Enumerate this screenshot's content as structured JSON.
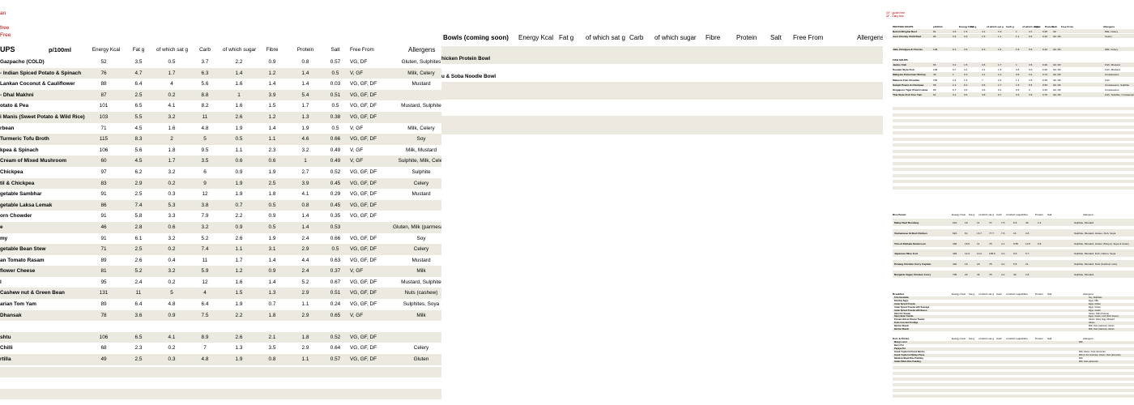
{
  "left": {
    "legend": [
      "an",
      "free",
      "Free"
    ],
    "header": {
      "section": "UPS",
      "per": "p/100ml",
      "kcal": "Energy Kcal",
      "fat": "Fat g",
      "sat": "of which sat g",
      "carb": "Carb",
      "sugar": "of which sugar",
      "fibre": "Fibre",
      "protein": "Protein",
      "salt": "Salt",
      "free": "Free From",
      "allergens": "Allergens"
    },
    "rows": [
      {
        "name": "Gazpacho (COLD)",
        "kcal": "52",
        "fat": "3.5",
        "sat": "0.5",
        "carb": "3.7",
        "sugar": "2.2",
        "fibre": "0.9",
        "protein": "0.8",
        "salt": "0.57",
        "free": "VG, DF",
        "allergens": "Gluten, Sulphites"
      },
      {
        "name": "- Indian Spiced Potato & Spinach",
        "kcal": "76",
        "fat": "4.7",
        "sat": "1.7",
        "carb": "6.3",
        "sugar": "1.4",
        "fibre": "1.2",
        "protein": "1.4",
        "salt": "0.5",
        "free": "V, GF",
        "allergens": "Milk, Celery"
      },
      {
        "name": "Lankan Coconut & Cauliflower",
        "kcal": "88",
        "fat": "6.4",
        "sat": "4",
        "carb": "5.6",
        "sugar": "1.6",
        "fibre": "1.4",
        "protein": "1.4",
        "salt": "0.03",
        "free": "VG, GF, DF",
        "allergens": "Mustard"
      },
      {
        "name": "- Dhal Makhni",
        "kcal": "87",
        "fat": "2.5",
        "sat": "0.2",
        "carb": "8.8",
        "sugar": "1",
        "fibre": "3.9",
        "protein": "5.4",
        "salt": "0.51",
        "free": "VG, GF, DF",
        "allergens": ""
      },
      {
        "name": "otato & Pea",
        "kcal": "101",
        "fat": "6.5",
        "sat": "4.1",
        "carb": "8.2",
        "sugar": "1.6",
        "fibre": "1.5",
        "protein": "1.7",
        "salt": "0.5",
        "free": "VG, GF, DF",
        "allergens": "Mustard, Sulphite"
      },
      {
        "name": "i Manis (Sweet Potato & Wild Rice)",
        "kcal": "103",
        "fat": "5.5",
        "sat": "3.2",
        "carb": "11",
        "sugar": "2.6",
        "fibre": "1.2",
        "protein": "1.3",
        "salt": "0.38",
        "free": "VG, GF, DF",
        "allergens": ""
      },
      {
        "name": "rbean",
        "kcal": "71",
        "fat": "4.5",
        "sat": "1.6",
        "carb": "4.8",
        "sugar": "1.9",
        "fibre": "1.4",
        "protein": "1.9",
        "salt": "0.5",
        "free": "V, GF",
        "allergens": "Milk, Celery"
      },
      {
        "name": "Turmeric Tofu Broth",
        "kcal": "115",
        "fat": "8.3",
        "sat": "2",
        "carb": "5",
        "sugar": "0.5",
        "fibre": "1.1",
        "protein": "4.6",
        "salt": "0.66",
        "free": "VG, GF, DF",
        "allergens": "Soy"
      },
      {
        "name": "kpea & Spinach",
        "kcal": "106",
        "fat": "5.6",
        "sat": "1.8",
        "carb": "9.5",
        "sugar": "1.1",
        "fibre": "2.3",
        "protein": "3.2",
        "salt": "0.49",
        "free": "V, GF",
        "allergens": "Milk, Mustard"
      },
      {
        "name": "Cream of Mixed Mushroom",
        "kcal": "60",
        "fat": "4.5",
        "sat": "1.7",
        "carb": "3.5",
        "sugar": "0.6",
        "fibre": "0.6",
        "protein": "1",
        "salt": "0.49",
        "free": "V, GF",
        "allergens": "Sulphite, Milk, Celer"
      },
      {
        "name": "Chickpea",
        "kcal": "97",
        "fat": "6.2",
        "sat": "3.2",
        "carb": "6",
        "sugar": "0.9",
        "fibre": "1.9",
        "protein": "2.7",
        "salt": "0.52",
        "free": "VG, GF, DF",
        "allergens": "Sulphite"
      },
      {
        "name": "til & Chickpea",
        "kcal": "83",
        "fat": "2.9",
        "sat": "0.2",
        "carb": "9",
        "sugar": "1.9",
        "fibre": "2.5",
        "protein": "3.9",
        "salt": "0.45",
        "free": "VG, GF, DF",
        "allergens": "Celery"
      },
      {
        "name": "getable Sambhar",
        "kcal": "91",
        "fat": "2.5",
        "sat": "0.3",
        "carb": "12",
        "sugar": "1.9",
        "fibre": "1.8",
        "protein": "4.1",
        "salt": "0.29",
        "free": "VG, GF, DF",
        "allergens": "Mustard"
      },
      {
        "name": "getable Laksa Lemak",
        "kcal": "86",
        "fat": "7.4",
        "sat": "5.3",
        "carb": "3.8",
        "sugar": "0.7",
        "fibre": "0.5",
        "protein": "0.8",
        "salt": "0.45",
        "free": "VG, GF, DF",
        "allergens": ""
      },
      {
        "name": "orn Chowder",
        "kcal": "91",
        "fat": "5.8",
        "sat": "3.3",
        "carb": "7.9",
        "sugar": "2.2",
        "fibre": "0.9",
        "protein": "1.4",
        "salt": "0.35",
        "free": "VG, GF, DF",
        "allergens": ""
      },
      {
        "name": "e",
        "kcal": "46",
        "fat": "2.8",
        "sat": "0.6",
        "carb": "3.2",
        "sugar": "0.9",
        "fibre": "0.5",
        "protein": "1.4",
        "salt": "0.53",
        "free": "",
        "allergens": "Gluten, Milk (parmesan),"
      },
      {
        "name": "my",
        "kcal": "91",
        "fat": "6.1",
        "sat": "3.2",
        "carb": "5.2",
        "sugar": "2.6",
        "fibre": "1.9",
        "protein": "2.4",
        "salt": "0.66",
        "free": "VG, GF, DF",
        "allergens": "Soy"
      },
      {
        "name": "getable Bean Stew",
        "kcal": "71",
        "fat": "2.5",
        "sat": "0.2",
        "carb": "7.4",
        "sugar": "1.1",
        "fibre": "3.1",
        "protein": "2.9",
        "salt": "0.5",
        "free": "VG, GF, DF",
        "allergens": "Celery"
      },
      {
        "name": "an Tomato Rasam",
        "kcal": "89",
        "fat": "2.6",
        "sat": "0.4",
        "carb": "11",
        "sugar": "1.7",
        "fibre": "1.4",
        "protein": "4.4",
        "salt": "0.63",
        "free": "VG, GF, DF",
        "allergens": "Mustard"
      },
      {
        "name": "flower Cheese",
        "kcal": "81",
        "fat": "5.2",
        "sat": "3.2",
        "carb": "5.9",
        "sugar": "1.2",
        "fibre": "0.9",
        "protein": "2.4",
        "salt": "0.37",
        "free": "V, GF",
        "allergens": "Milk"
      },
      {
        "name": "l",
        "kcal": "95",
        "fat": "2.4",
        "sat": "0.2",
        "carb": "12",
        "sugar": "1.6",
        "fibre": "1.4",
        "protein": "5.2",
        "salt": "0.67",
        "free": "VG, GF, DF",
        "allergens": "Mustard, Sulphite"
      },
      {
        "name": "Cashew nut & Green Bean",
        "kcal": "131",
        "fat": "11",
        "sat": "5",
        "carb": "4",
        "sugar": "1.5",
        "fibre": "1.3",
        "protein": "2.9",
        "salt": "0.51",
        "free": "VG, GF, DF",
        "allergens": "Nuts (cashew)"
      },
      {
        "name": "arian Tom Yam",
        "kcal": "89",
        "fat": "6.4",
        "sat": "4.8",
        "carb": "6.4",
        "sugar": "1.9",
        "fibre": "0.7",
        "protein": "1.1",
        "salt": "0.24",
        "free": "VG, GF, DF",
        "allergens": "Sulphites, Soya"
      },
      {
        "name": "Dhansak",
        "kcal": "78",
        "fat": "3.6",
        "sat": "0.9",
        "carb": "7.5",
        "sugar": "2.2",
        "fibre": "1.8",
        "protein": "2.9",
        "salt": "0.65",
        "free": "V, GF",
        "allergens": "Milk"
      },
      {
        "name": "",
        "kcal": "",
        "fat": "",
        "sat": "",
        "carb": "",
        "sugar": "",
        "fibre": "",
        "protein": "",
        "salt": "",
        "free": "",
        "allergens": ""
      },
      {
        "name": "shtu",
        "kcal": "106",
        "fat": "6.5",
        "sat": "4.1",
        "carb": "8.9",
        "sugar": "2.6",
        "fibre": "2.1",
        "protein": "1.8",
        "salt": "0.52",
        "free": "VG, GF, DF",
        "allergens": ""
      },
      {
        "name": "Chilli",
        "kcal": "68",
        "fat": "2.3",
        "sat": "0.2",
        "carb": "7",
        "sugar": "1.3",
        "fibre": "3.5",
        "protein": "2.9",
        "salt": "0.64",
        "free": "VG, GF, DF",
        "allergens": "Celery"
      },
      {
        "name": "rtilla",
        "kcal": "49",
        "fat": "2.5",
        "sat": "0.3",
        "carb": "4.8",
        "sugar": "1.9",
        "fibre": "0.8",
        "protein": "1.1",
        "salt": "0.57",
        "free": "VG, GF, DF",
        "allergens": "Gluten"
      }
    ]
  },
  "mid": {
    "header": {
      "title": "Bowls (coming soon)",
      "kcal": "Energy Kcal",
      "fat": "Fat g",
      "sat": "of which sat g",
      "carb": "Carb",
      "sugar": "of which sugar",
      "fibre": "Fibre",
      "protein": "Protein",
      "salt": "Salt",
      "free": "Free From",
      "allergens": "Allergens"
    },
    "items": [
      "hicken Protein Bowl",
      "u & Soba Noodle Bowl"
    ]
  },
  "right": {
    "legend": [
      "GF - gluten free",
      "DF - Dairy free"
    ],
    "header": [
      "PROTEIN SOUPS",
      "p/100ml",
      "Energy Kcal",
      "Fat g",
      "of which sat g",
      "Carb g",
      "of which sugar",
      "Fibre",
      "Protein",
      "Salt",
      "Free From",
      "Allergens"
    ],
    "protein_rows": [
      {
        "name": "Rehoti Minghai Beef",
        "vals": [
          "81",
          "4.6",
          "1.5",
          "4.1",
          "1.5",
          "1",
          "4.1",
          "0.45",
          "GF"
        ],
        "all": "Milk, Celery"
      },
      {
        "name": "Aura Chunky Chilli Beef",
        "vals": [
          "96",
          "3.5",
          "0.3",
          "1.5",
          "1.1",
          "1.1",
          "9.6",
          "0.44",
          "GF, DF"
        ],
        "all": "Celery"
      },
      {
        "name": "Jaku Chickpea & Chorizo",
        "vals": [
          "108",
          "6.1",
          "2.6",
          "8.3",
          "1.5",
          "1.8",
          "5.6",
          "0.43",
          "GF, DF"
        ],
        "all": "Milk, Celery"
      }
    ],
    "fish_title": "FISH SOUPS",
    "fish_rows": [
      {
        "name": "Jambo Fish",
        "vals": [
          "66",
          "3.4",
          "1.5",
          "4.6",
          "1.7",
          "1",
          "3.6",
          "0.49",
          "GF, DF"
        ],
        "all": "Fish, Mustard"
      },
      {
        "name": "Keralan Style Fish",
        "vals": [
          "108",
          "6.7",
          "4.1",
          "4.1",
          "1.5",
          "0.6",
          "6.9",
          "0.46",
          "GF, DF"
        ],
        "all": "Fish, Mustard"
      },
      {
        "name": "Malaysia Fisherman Shrimp",
        "vals": [
          "46",
          "1",
          "0.3",
          "4.1",
          "2.1",
          "0.8",
          "3.4",
          "0.74",
          "GF, DF"
        ],
        "all": "Crustaceans"
      },
      {
        "name": "Malacca Fish Chowder",
        "vals": [
          "150",
          "2.4",
          "1.6",
          "7",
          "2.3",
          "1.1",
          "4.5",
          "0.45",
          "GF, DF"
        ],
        "all": "Fish"
      },
      {
        "name": "Sampit Prawn & Chickpea",
        "vals": [
          "96",
          "2.1",
          "0.2",
          "9.6",
          "1.7",
          "1.5",
          "5.5",
          "0.54",
          "GF, DF"
        ],
        "all": "Crustaceans, Sulphite"
      },
      {
        "name": "Singapore Tiger Prawn Laksa",
        "vals": [
          "86",
          "6.7",
          "4.6",
          "4.6",
          "0.1",
          "0.5",
          "3",
          "0.46",
          "GF, DF"
        ],
        "all": "Crustaceans"
      },
      {
        "name": "Thai Style Fish Tom Yam",
        "vals": [
          "61",
          "3.1",
          "0.6",
          "3.8",
          "0.7",
          "0.3",
          "3.9",
          "0.79",
          "GF, DF"
        ],
        "all": "Fish, Sulphite, Crustaceans"
      }
    ],
    "rice_header": [
      "Rice Bowls",
      "Energy Kcal",
      "Fat g",
      "of which sat g",
      "Carb",
      "of which sugar",
      "Fibre",
      "Protein",
      "Salt",
      "Allergens"
    ],
    "rice_rows": [
      {
        "name": "Malay Beef Rendang",
        "vals": [
          "201",
          "18",
          "11",
          "74",
          "7.6",
          "6.9",
          "49",
          "2.2"
        ],
        "all": "Sulphite, Mustard"
      },
      {
        "name": "Vietnamese Grilled Chicken",
        "vals": [
          "624",
          "61",
          "13.7",
          "77.7",
          "7.6",
          "16",
          "3.6"
        ],
        "all": "Sulphite, Mustard, Gluten, Fish, Soya"
      },
      {
        "name": "Tofu & Shiitake Mushroom",
        "vals": [
          "436",
          "15.6",
          "11",
          "78",
          "4.1",
          "5.55",
          "12.5",
          "0.8"
        ],
        "all": "Sulphite, Mustard, Gluten (Shoyu), Soya & Celery"
      },
      {
        "name": "Japanese Miso Cod",
        "vals": [
          "435",
          "12.3",
          "12.2",
          "105.6",
          "3.2",
          "9.6",
          "5.7"
        ],
        "all": "Sulphite, Mustard, Fish, Gluten, Soya"
      },
      {
        "name": "Penang Chicken Curry Captain",
        "vals": [
          "440",
          "18",
          "18",
          "78",
          "4.2",
          "5.6",
          "21"
        ],
        "all": "Sulphite, Mustard, Nuts (Cashew nuts)"
      },
      {
        "name": "Bangkok Vegan Chicken Curry",
        "vals": [
          "706",
          "29",
          "34",
          "78",
          "4.2",
          "39",
          "2.8"
        ],
        "all": "Sulphite, Mustard,"
      }
    ],
    "breakfast_header": [
      "Breakfast",
      "Energy Kcal",
      "Fat g",
      "of which sat g",
      "Carb",
      "of which sugar",
      "Fibre",
      "Protein",
      "Salt",
      "Allergens"
    ],
    "breakfast_rows": [
      {
        "name": "Tofu Scramble",
        "all": "Soy, Sulphites"
      },
      {
        "name": "Bombay Eggs",
        "all": "Eggs, Milk"
      },
      {
        "name": "Asian Spiced Toastie",
        "all": "Eggs, Gluten"
      },
      {
        "name": "Asian Spiced Toastie with Sausage",
        "all": "Eggs, Gluten"
      },
      {
        "name": "Asian Spiced Toastie with Bacon",
        "all": "Eggs, Gluten"
      },
      {
        "name": "Kimi Chi Toastie",
        "all": "Gluten, Milk (Cheese)"
      },
      {
        "name": "Spicy Bean Toastie",
        "all": "Eggs, Gluten, Fish (Fish Sauce)"
      },
      {
        "name": "Korean Ham & Cheese Toastie",
        "all": "Gluten, Dairy, Egg, Mustard"
      },
      {
        "name": "Kodo Coconut Porridge",
        "all": "Gluten"
      },
      {
        "name": "Bircher Muesli",
        "all": "Milk, Nuts (walnuts), Gluten"
      },
      {
        "name": "Bircher Muesli",
        "all": "Milk, Nuts (walnuts), Gluten"
      }
    ],
    "pots_header": [
      "Pots & Drinks",
      "Energy Kcal",
      "Fat g",
      "of which sat g",
      "Carb",
      "of which sugar",
      "Fibre",
      "Protein",
      "Salt",
      "Allergens"
    ],
    "pots_rows": [
      {
        "name": "Mango Lassi",
        "all": "Milk"
      },
      {
        "name": "Berry Pot",
        "all": ""
      },
      {
        "name": "Papaya Pot",
        "all": ""
      },
      {
        "name": "Greek Yoghurt & Fresh Berries",
        "all": "Milk, Gluten, Nuts (almonds)"
      },
      {
        "name": "Greek Yoghurt & Mango Puree",
        "all": "Milk (in the Granola), Gluten, Nuts (almonds)"
      },
      {
        "name": "Rainbow Black Rice Pudding",
        "all": "Milk"
      },
      {
        "name": "Indian White Rice Pudding",
        "all": "Milk, Nuts (almonds)"
      }
    ]
  }
}
